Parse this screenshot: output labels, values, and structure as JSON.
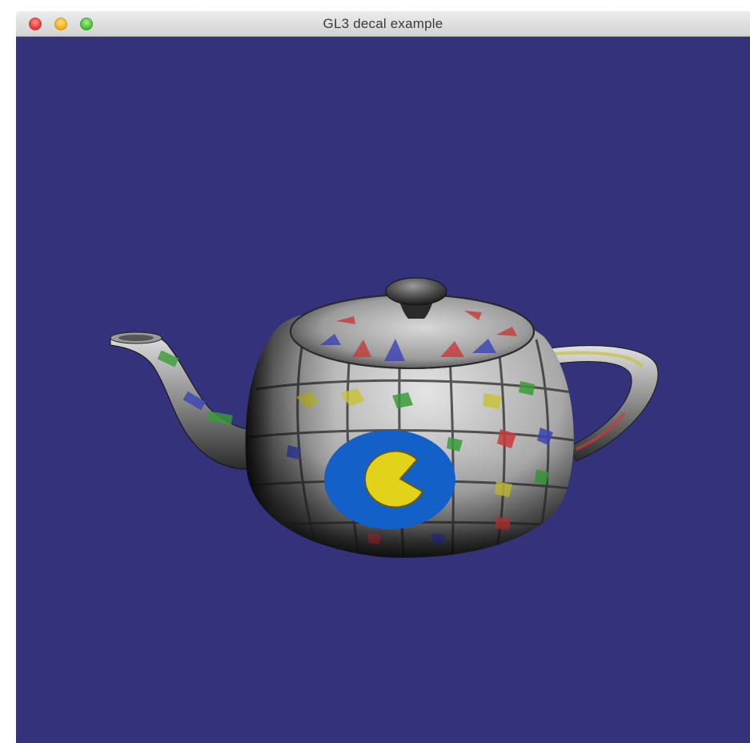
{
  "window": {
    "title": "GL3 decal example"
  },
  "viewport": {
    "background_color": "#33327a",
    "model": "teapot",
    "decal": "pacman-icon"
  },
  "colors": {
    "decal_disc": "#1260c8",
    "decal_pacman": "#e3d21a",
    "tile_red": "#c83a3a",
    "tile_blue": "#3a44b6",
    "tile_green": "#3a9c3a",
    "tile_yellow": "#c8c23a"
  }
}
